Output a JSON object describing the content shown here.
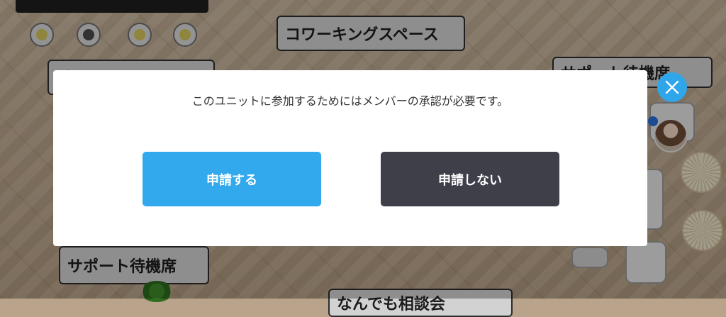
{
  "background": {
    "labels": [
      "コワーキングスペース",
      "受付リフチ",
      "サポート待機席",
      "サポート待機席",
      "なんでも相談会"
    ]
  },
  "modal": {
    "message": "このユニットに参加するためにはメンバーの承認が必要です。",
    "apply_label": "申請する",
    "decline_label": "申請しない"
  },
  "colors": {
    "apply": "#31a9ec",
    "decline": "#3f3f4a",
    "close": "#2fa5ea"
  },
  "icons": {
    "close": "close-icon"
  }
}
